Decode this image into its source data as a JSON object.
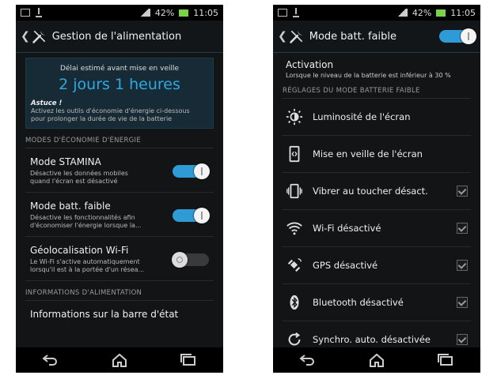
{
  "left": {
    "status": {
      "battery": "42%",
      "time": "11:05"
    },
    "title": "Gestion de l'alimentation",
    "estimate_label": "Délai estimé avant mise en veille",
    "estimate_value": "2 jours 1 heures",
    "tip_title": "Astuce !",
    "tip_line1": "Activez les outils d'économie d'énergie ci-dessous",
    "tip_line2": "pour prolonger la durée de vie de la batterie",
    "section_modes": "MODES D'ÉCONOMIE D'ÉNERGIE",
    "items": [
      {
        "title": "Mode STAMINA",
        "sub1": "Désactive les données mobiles",
        "sub2": "quand l'écran est désactivé",
        "on": true
      },
      {
        "title": "Mode batt. faible",
        "sub1": "Désactive les fonctionnalités afin",
        "sub2": "d'économiser l'énergie lorsque la...",
        "on": true
      },
      {
        "title": "Géolocalisation Wi-Fi",
        "sub1": "Le Wi-Fi s'active automatiquement",
        "sub2": "lorsqu'il est à la portée d'un résea...",
        "on": false
      }
    ],
    "section_info": "INFORMATIONS D'ALIMENTATION",
    "info_item": "Informations sur la barre d'état"
  },
  "right": {
    "status": {
      "battery": "42%",
      "time": "11:05"
    },
    "title": "Mode batt. faible",
    "activation_title": "Activation",
    "activation_sub": "Lorsque le niveau de la batterie est inférieur à 30 %",
    "section": "RÉGLAGES DU MODE BATTERIE FAIBLE",
    "items": [
      {
        "label": "Luminosité de l'écran",
        "icon": "brightness-icon",
        "checkbox": false
      },
      {
        "label": "Mise en veille de l'écran",
        "icon": "screen-sleep-icon",
        "checkbox": false
      },
      {
        "label": "Vibrer au toucher désact.",
        "icon": "vibrate-icon",
        "checkbox": true
      },
      {
        "label": "Wi-Fi désactivé",
        "icon": "wifi-icon",
        "checkbox": true
      },
      {
        "label": "GPS désactivé",
        "icon": "gps-icon",
        "checkbox": true
      },
      {
        "label": "Bluetooth désactivé",
        "icon": "bluetooth-icon",
        "checkbox": true
      },
      {
        "label": "Synchro. auto. désactivée",
        "icon": "sync-icon",
        "checkbox": true
      }
    ]
  },
  "colors": {
    "accent": "#2ea9e0",
    "switch_on": "#2e9bd6",
    "background": "#121416"
  }
}
